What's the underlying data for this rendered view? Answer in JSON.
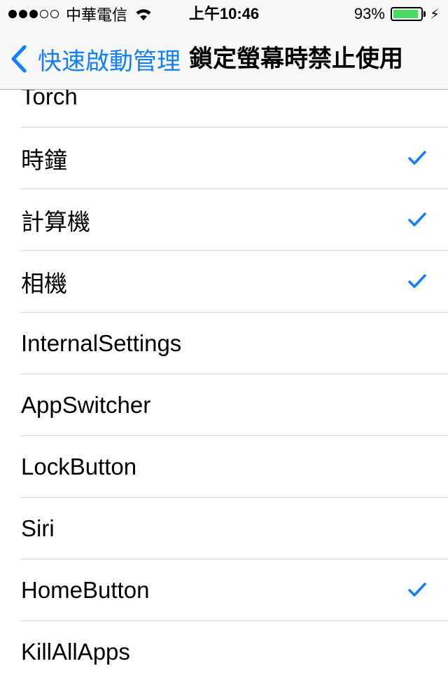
{
  "status_bar": {
    "carrier": "中華電信",
    "time": "上午10:46",
    "battery_percent": "93%",
    "battery_level": 0.93,
    "signal_bars_on": 3,
    "signal_bars_total": 5,
    "icons": [
      "wifi-icon",
      "battery-icon",
      "charging-bolt-icon"
    ]
  },
  "nav": {
    "back_label": "快速啟動管理",
    "title": "鎖定螢幕時禁止使用"
  },
  "colors": {
    "accent": "#147efb",
    "battery_fill": "#4cd964"
  },
  "list": {
    "items": [
      {
        "label": "Torch",
        "checked": false
      },
      {
        "label": "時鐘",
        "checked": true
      },
      {
        "label": "計算機",
        "checked": true
      },
      {
        "label": "相機",
        "checked": true
      },
      {
        "label": "InternalSettings",
        "checked": false
      },
      {
        "label": "AppSwitcher",
        "checked": false
      },
      {
        "label": "LockButton",
        "checked": false
      },
      {
        "label": "Siri",
        "checked": false
      },
      {
        "label": "HomeButton",
        "checked": true
      },
      {
        "label": "KillAllApps",
        "checked": false
      }
    ]
  }
}
